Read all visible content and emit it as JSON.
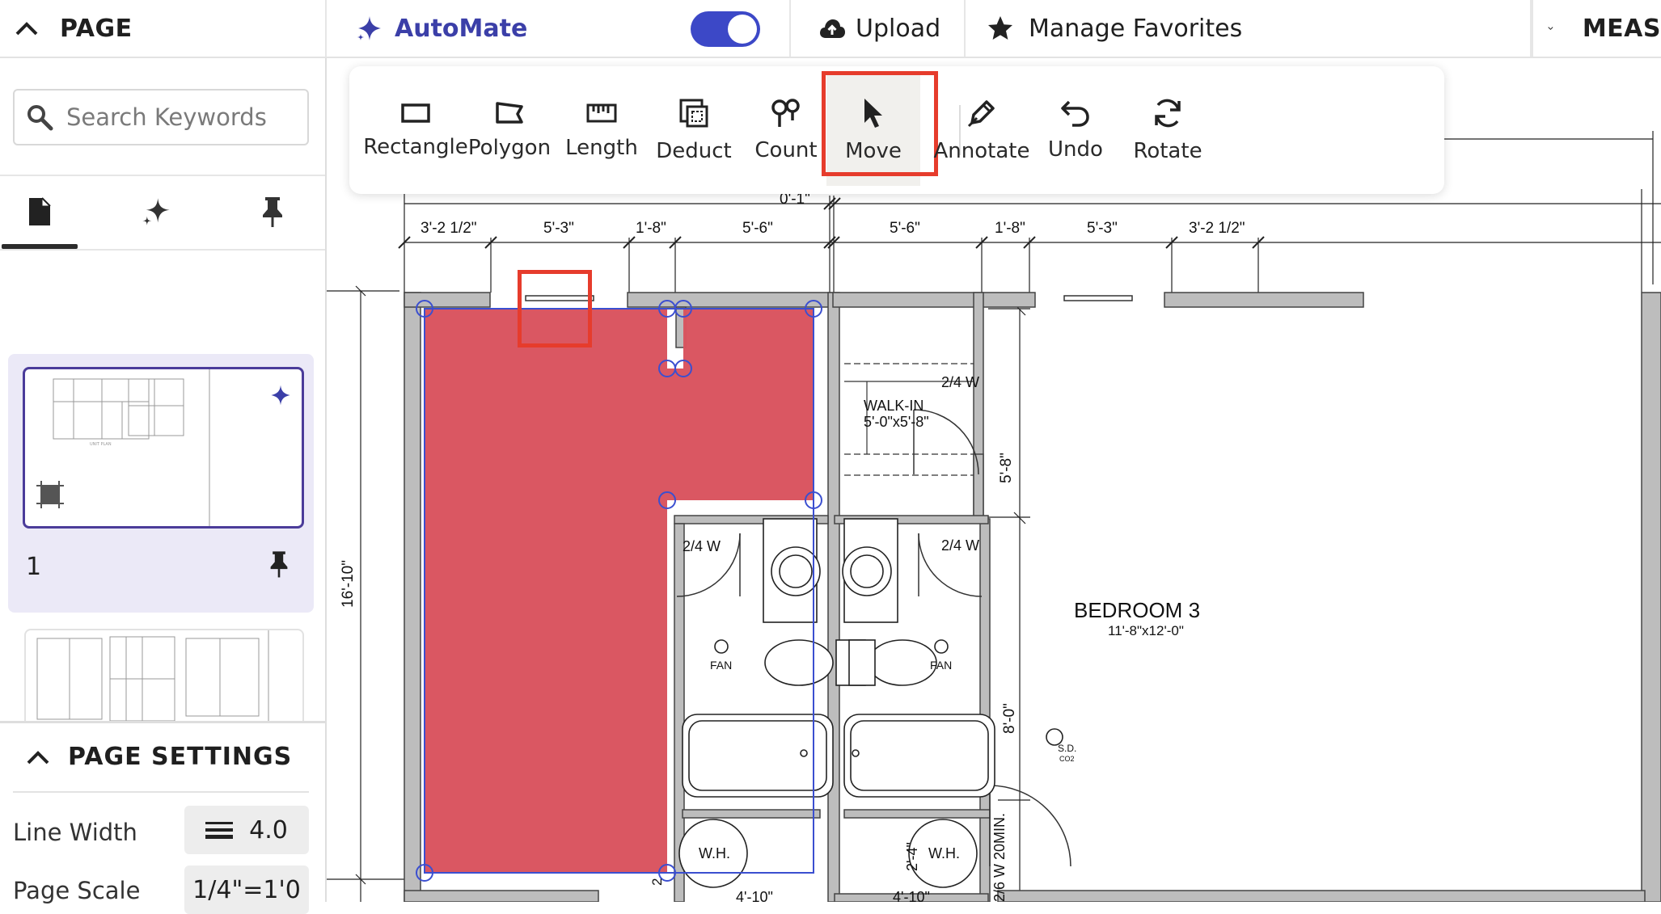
{
  "header": {
    "page_label": "PAGE",
    "automate_label": "AutoMate",
    "automate_enabled": true,
    "upload_label": "Upload",
    "favorites_label": "Manage Favorites",
    "measure_label": "MEAS"
  },
  "sidebar": {
    "search_placeholder": "Search Keywords",
    "tabs": [
      "pages-icon",
      "sparkle-icon",
      "pin-icon"
    ],
    "pages": [
      {
        "number": "1",
        "selected": true
      },
      {
        "number": "",
        "selected": false
      }
    ],
    "settings_title": "PAGE SETTINGS",
    "line_width_label": "Line Width",
    "line_width_value": "4.0",
    "page_scale_label": "Page Scale",
    "page_scale_value": "1/4\"=1'0"
  },
  "toolbar": {
    "tools": [
      {
        "label": "Rectangle",
        "icon": "rectangle-icon"
      },
      {
        "label": "Polygon",
        "icon": "polygon-icon"
      },
      {
        "label": "Length",
        "icon": "ruler-icon"
      },
      {
        "label": "Deduct",
        "icon": "deduct-icon"
      },
      {
        "label": "Count",
        "icon": "count-icon"
      },
      {
        "label": "Move",
        "icon": "cursor-icon",
        "selected": true
      },
      {
        "label": "Annotate",
        "icon": "pencil-icon"
      },
      {
        "label": "Undo",
        "icon": "undo-icon"
      },
      {
        "label": "Rotate",
        "icon": "rotate-icon"
      }
    ]
  },
  "drawing": {
    "dims_top": [
      "3'-2 1/2\"",
      "5'-3\"",
      "1'-8\"",
      "5'-6\"",
      "0'-1\"",
      "5'-6\"",
      "1'-8\"",
      "5'-3\"",
      "3'-2 1/2\""
    ],
    "dim_left": "16'-10\"",
    "walkin_title": "WALK-IN",
    "walkin_size": "5'-0\"x5'-8\"",
    "door_labels": [
      "2/4 W",
      "2/4 W",
      "2/4 W"
    ],
    "dim_5_8": "5'-8\"",
    "dim_8_0": "8'-0\"",
    "fan_label": "FAN",
    "bedroom_title": "BEDROOM 3",
    "bedroom_size": "11'-8\"x12'-0\"",
    "sd_label": "S.D.",
    "co2_label": "CO2",
    "wh_label": "W.H.",
    "dim_2_4": "2'-4\"",
    "dim_door": "2/6 W 20MIN.",
    "dim_4_10": "4'-10\"",
    "dim_4_10b": "4'-10\"",
    "dim_2": "2",
    "region_color": "#d9545f",
    "handle_color": "#3b4fd0"
  }
}
